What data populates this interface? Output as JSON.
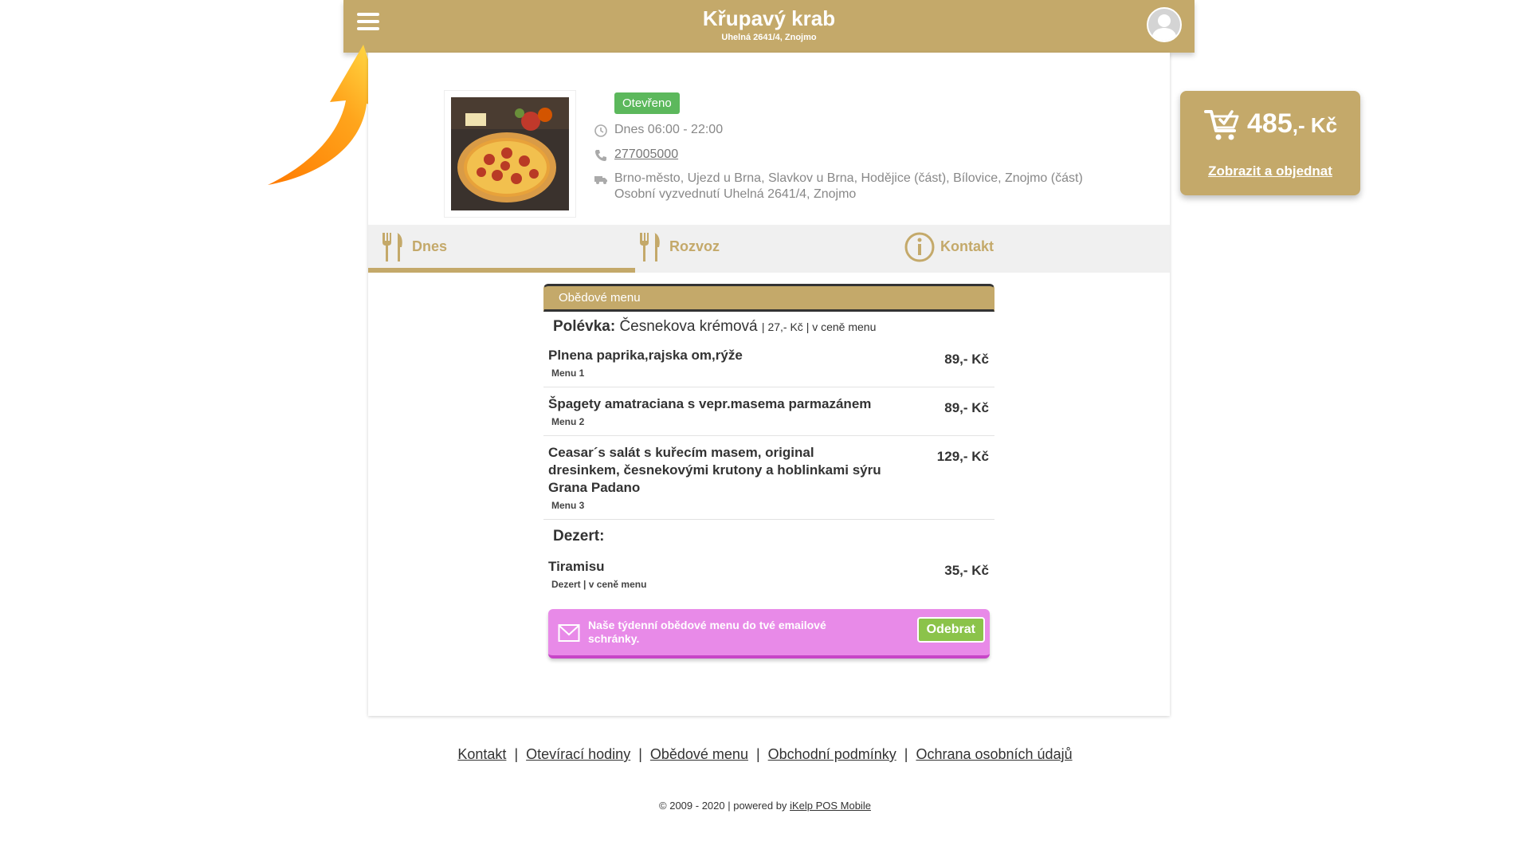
{
  "header": {
    "title": "Křupavý krab",
    "address": "Uhelná 2641/4, Znojmo",
    "menu_icon": "hamburger-icon",
    "avatar_icon": "user-avatar-icon"
  },
  "restaurant": {
    "status": "Otevřeno",
    "hours": "Dnes 06:00 - 22:00",
    "phone": "277005000",
    "delivery_areas": "Brno-město, Ujezd u Brna, Slavkov u Brna, Hodějice (část), Bílovice, Znojmo (část)",
    "pickup": "Osobní vyzvednutí Uhelná 2641/4, Znojmo"
  },
  "tabs": [
    {
      "label": "Dnes",
      "icon": "fork-knife-icon"
    },
    {
      "label": "Rozvoz",
      "icon": "fork-knife-icon"
    },
    {
      "label": "Kontakt",
      "icon": "info-icon"
    }
  ],
  "menu": {
    "header": "Obědové menu",
    "soup_label": "Polévka:",
    "soup_name": "Česnekova krémová",
    "soup_extra": "| 27,- Kč | v ceně menu",
    "items": [
      {
        "name": "Plnena paprika,rajska om,rýže",
        "sub": "Menu 1",
        "price": "89,- Kč"
      },
      {
        "name": "Špagety amatraciana s vepr.masema parmazánem",
        "sub": "Menu 2",
        "price": "89,- Kč"
      },
      {
        "name": "Ceasar´s salát s kuřecím masem, original dresinkem, česnekovými krutony a hoblinkami sýru Grana Padano",
        "sub": "Menu 3",
        "price": "129,- Kč"
      }
    ],
    "dessert_label": "Dezert:",
    "dessert": {
      "name": "Tiramisu",
      "sub": "Dezert | v ceně menu",
      "price": "35,- Kč"
    }
  },
  "newsletter": {
    "text": "Naše týdenní obědové menu do tvé emailové schránky.",
    "button": "Odebrat"
  },
  "cart": {
    "amount": "485",
    "currency": ",- Kč",
    "link": "Zobrazit a objednat"
  },
  "footer": {
    "links": [
      "Kontakt",
      "Otevírací hodiny",
      "Obědové menu",
      "Obchodní podmínky",
      "Ochrana osobních údajů"
    ],
    "copyright": "© 2009 - 2020 | powered by",
    "powered": "iKelp POS Mobile"
  },
  "colors": {
    "brand": "#c4a96a",
    "open_badge": "#5cb85c",
    "newsletter": "#e88ae8",
    "subscribe": "#8bc34a"
  }
}
